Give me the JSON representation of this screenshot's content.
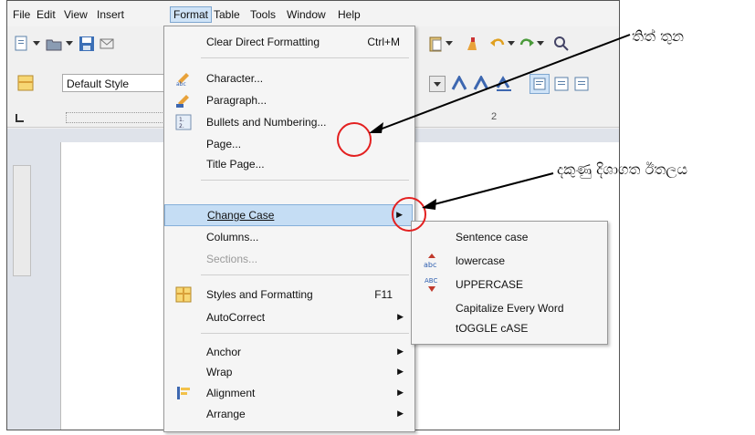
{
  "menubar": [
    "File",
    "Edit",
    "View",
    "Insert",
    "Format",
    "Table",
    "Tools",
    "Window",
    "Help"
  ],
  "active_menu": "Format",
  "style_box": "Default Style",
  "ruler_mark": "2",
  "format_menu": {
    "clear": {
      "label": "Clear Direct Formatting",
      "shortcut": "Ctrl+M"
    },
    "character": "Character...",
    "paragraph": "Paragraph...",
    "bullets": "Bullets and Numbering...",
    "page": "Page...",
    "title_page": "Title Page...",
    "change_case": "Change Case",
    "columns": "Columns...",
    "sections": "Sections...",
    "styles": {
      "label": "Styles and Formatting",
      "shortcut": "F11"
    },
    "autocorrect": "AutoCorrect",
    "anchor": "Anchor",
    "wrap": "Wrap",
    "alignment": "Alignment",
    "arrange": "Arrange"
  },
  "change_case_submenu": [
    "Sentence case",
    "lowercase",
    "UPPERCASE",
    "Capitalize Every Word",
    "tOGGLE cASE"
  ],
  "annotations": {
    "three_dots": "තිත් තුන",
    "right_arrow": "දකුණු දිශාගත ඊතලය"
  },
  "colors": {
    "highlight": "#c5ddf4",
    "circle": "#e32020",
    "menu_bg": "#f5f5f5"
  }
}
